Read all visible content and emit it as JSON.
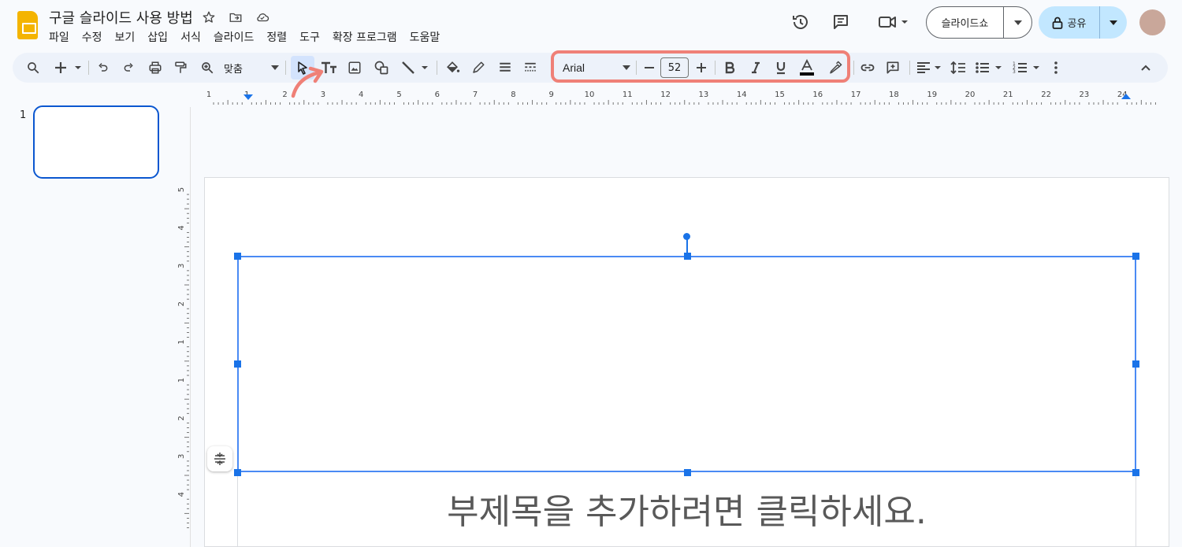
{
  "document": {
    "title": "구글 슬라이드 사용 방법"
  },
  "menu": [
    "파일",
    "수정",
    "보기",
    "삽입",
    "서식",
    "슬라이드",
    "정렬",
    "도구",
    "확장 프로그램",
    "도움말"
  ],
  "header": {
    "slideshow_label": "슬라이드쇼",
    "share_label": "공유"
  },
  "toolbar": {
    "zoom_value": "맞춤",
    "font_name": "Arial",
    "font_size": "52",
    "highlight_color": "#ef8077"
  },
  "ruler": {
    "horizontal_ticks": [
      "1",
      "1",
      "2",
      "3",
      "4",
      "5",
      "6",
      "7",
      "8",
      "9",
      "10",
      "11",
      "12",
      "13",
      "14",
      "15",
      "16",
      "17",
      "18",
      "19",
      "20",
      "21",
      "22",
      "23",
      "24"
    ],
    "vertical_ticks": [
      "5",
      "4",
      "3",
      "2",
      "1",
      "1",
      "2",
      "3",
      "4"
    ]
  },
  "filmstrip": {
    "slide_number": "1"
  },
  "slide": {
    "subtitle_placeholder": "부제목을 추가하려면 클릭하세요."
  }
}
